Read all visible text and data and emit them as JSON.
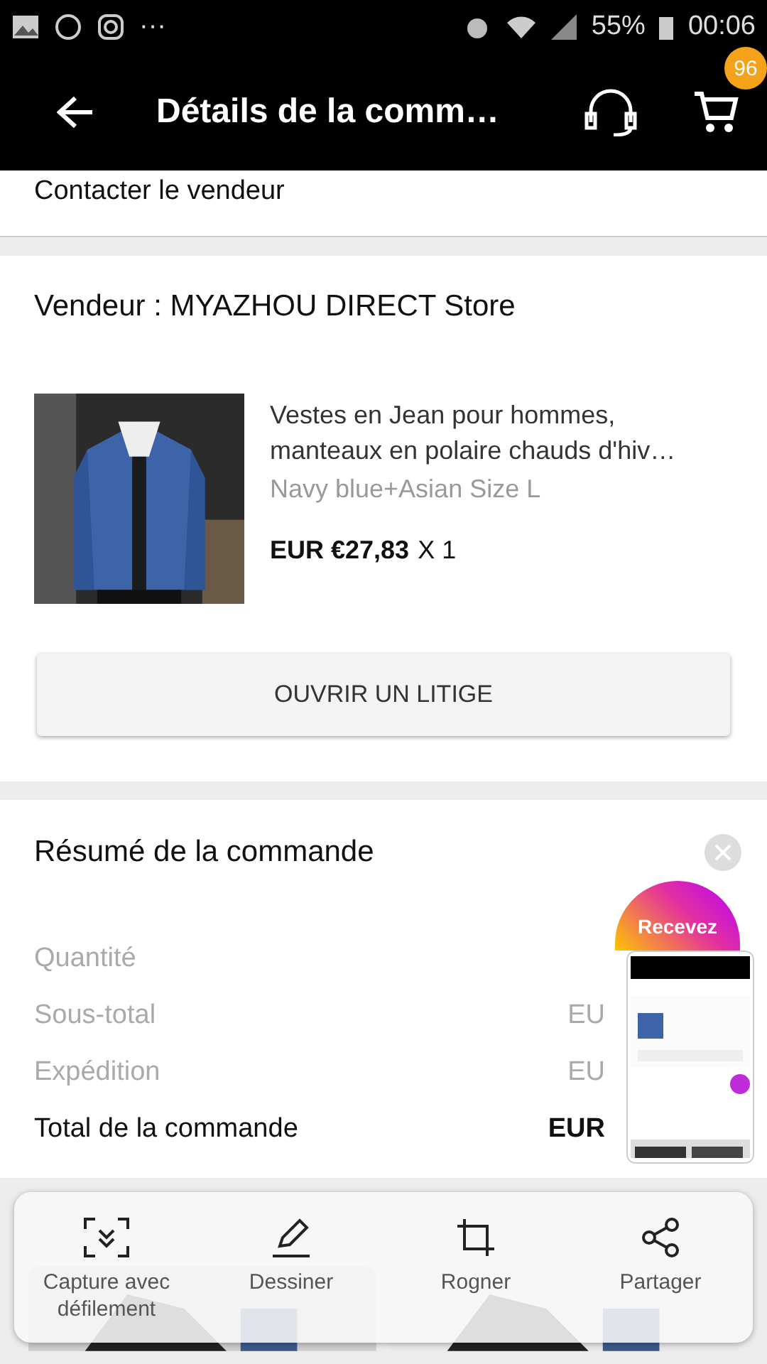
{
  "status_bar": {
    "battery": "55%",
    "time": "00:06",
    "notification_more": "···"
  },
  "app_bar": {
    "title": "Détails de la comm…",
    "cart_count": "96"
  },
  "contact": {
    "label": "Contacter le vendeur"
  },
  "seller": {
    "name": "Vendeur : MYAZHOU DIRECT Store",
    "product": {
      "kind": "picture",
      "title": "Vestes en Jean pour hommes, manteaux en polaire chauds d'hiv…",
      "variant": "Navy blue+Asian Size L",
      "price": "EUR €27,83",
      "quantity": "X 1"
    },
    "dispute_button": "OUVRIR UN LITIGE"
  },
  "summary": {
    "title": "Résumé de la commande",
    "promo": "Recevez",
    "rows": [
      {
        "label": "Quantité",
        "bold": false
      },
      {
        "label": "Sous-total",
        "value": "EU",
        "bold": false
      },
      {
        "label": "Expédition",
        "value": "EU",
        "bold": false
      },
      {
        "label": "Total de la commande",
        "value": "EUR",
        "bold": true
      }
    ]
  },
  "screenshot_toolbar": [
    {
      "kind": "scroll",
      "label": "Capture avec défilement"
    },
    {
      "kind": "draw",
      "label": "Dessiner"
    },
    {
      "kind": "crop",
      "label": "Rogner"
    },
    {
      "kind": "share",
      "label": "Partager"
    }
  ]
}
